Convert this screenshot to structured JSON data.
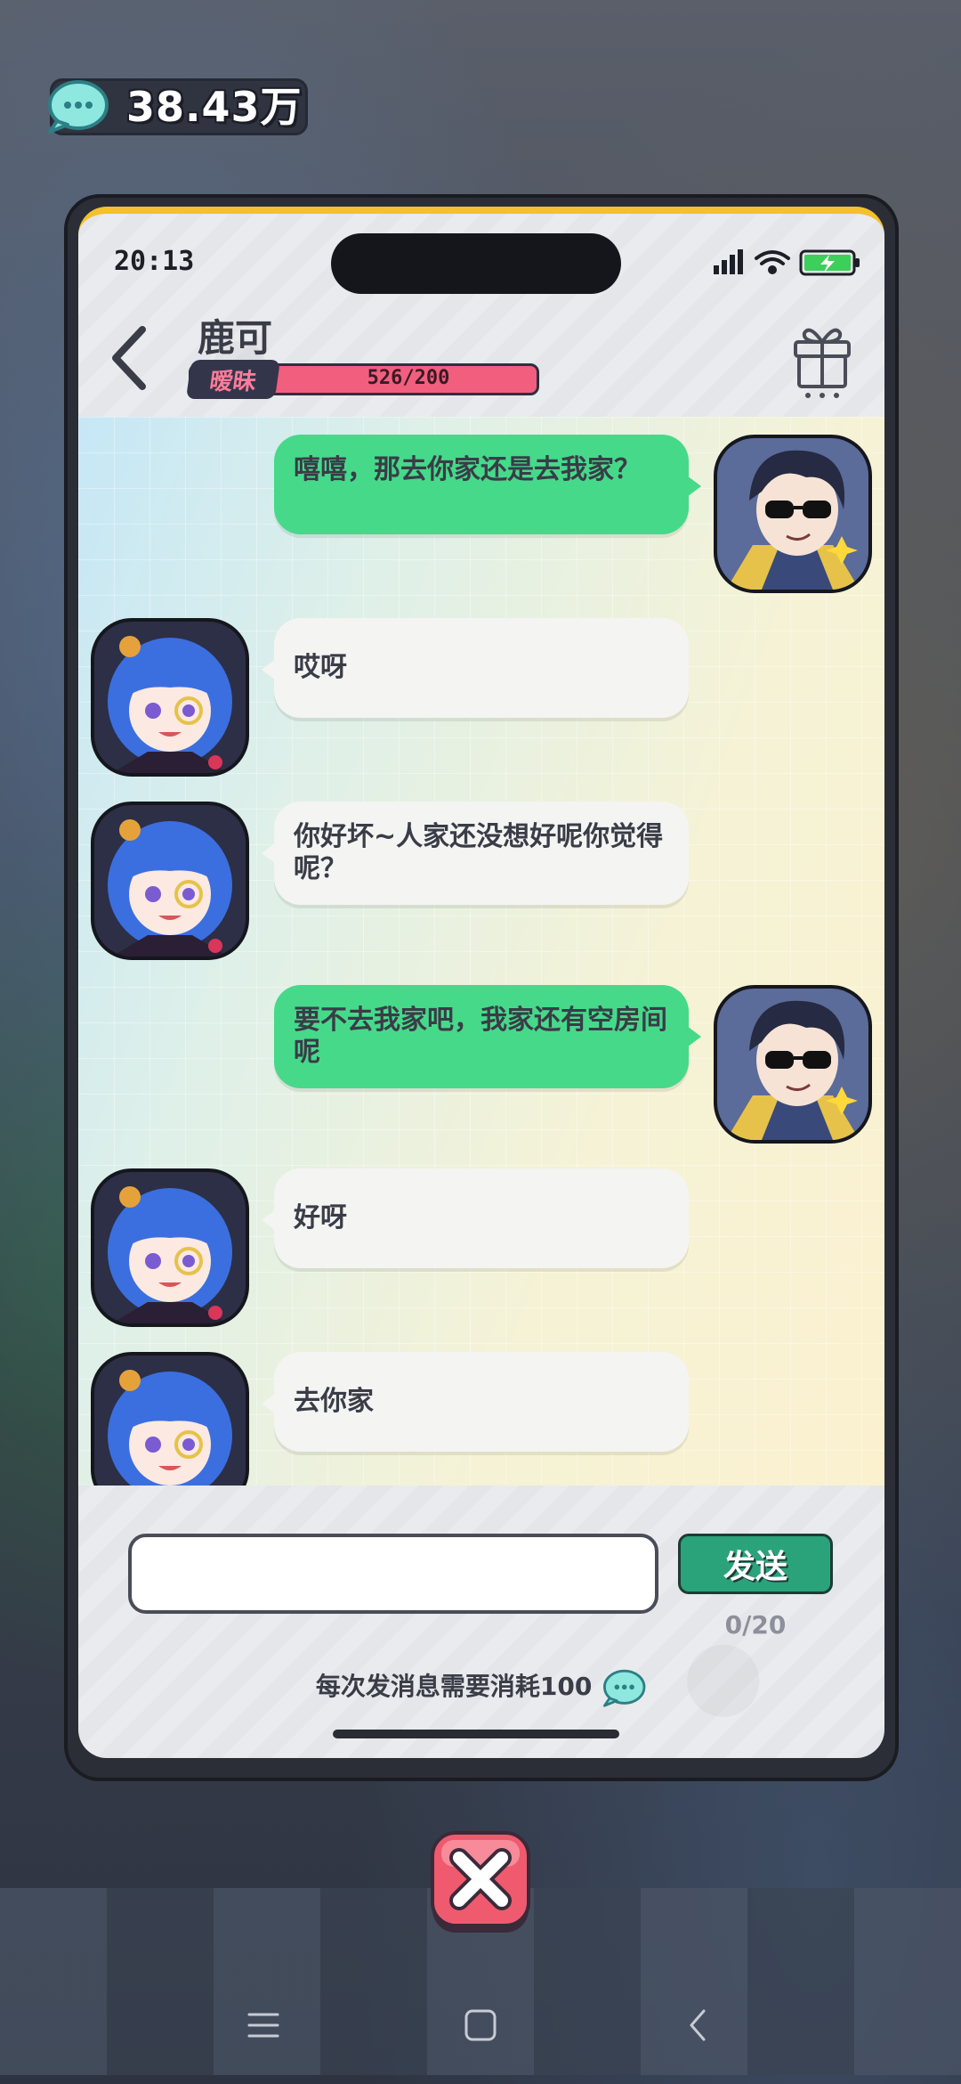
{
  "currency": {
    "value": "38.43万",
    "icon": "chat-coin-icon"
  },
  "status_bar": {
    "time": "20:13"
  },
  "header": {
    "contact_name": "鹿可",
    "relation_tag": "暧昧",
    "affinity_text": "526/200",
    "affinity_fraction": 1.0
  },
  "messages": [
    {
      "from": "me",
      "text": "嘻嘻，那去你家还是去我家？"
    },
    {
      "from": "her",
      "text": "哎呀"
    },
    {
      "from": "her",
      "text": "你好坏~人家还没想好呢你觉得呢？"
    },
    {
      "from": "me",
      "text": "要不去我家吧，我家还有空房间呢"
    },
    {
      "from": "her",
      "text": "好呀"
    },
    {
      "from": "her",
      "text": "去你家"
    }
  ],
  "composer": {
    "input_value": "",
    "send_label": "发送",
    "char_count": "0/20",
    "cost_note": "每次发消息需要消耗100"
  },
  "colors": {
    "my_bubble": "#46d98a",
    "her_bubble": "#f4f4f3",
    "affinity_bar": "#f25e7e",
    "send_button": "#2aa37a"
  }
}
